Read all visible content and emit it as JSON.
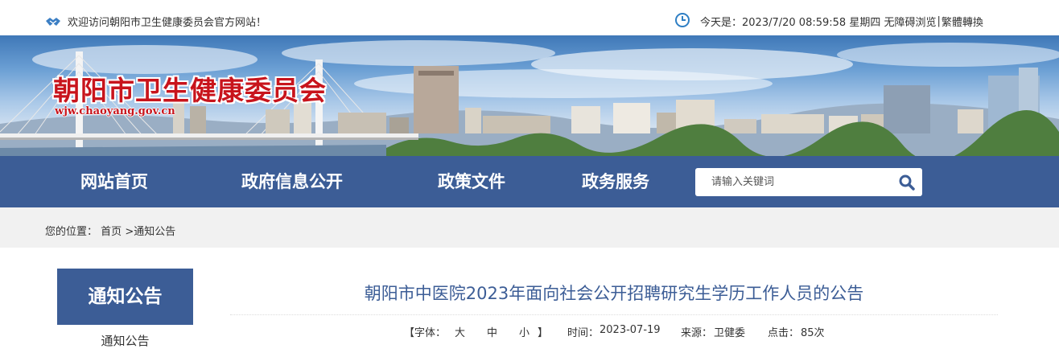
{
  "topbar": {
    "welcome": "欢迎访问朝阳市卫生健康委员会官方网站！",
    "date_prefix": "今天是：",
    "datetime": "2023/7/20 08:59:58 星期四",
    "accessible_link": "无障碍浏览",
    "separator": "|",
    "traditional_link": "繁體轉換"
  },
  "banner": {
    "site_title": "朝阳市卫生健康委员会",
    "site_url": "wjw.chaoyang.gov.cn"
  },
  "nav": {
    "items": [
      {
        "label": "网站首页"
      },
      {
        "label": "政府信息公开"
      },
      {
        "label": "政策文件"
      },
      {
        "label": "政务服务"
      }
    ],
    "search_placeholder": "请输入关键词"
  },
  "breadcrumb": {
    "prefix": "您的位置：",
    "home": "首页",
    "arrow": ">",
    "current": "通知公告"
  },
  "sidebar": {
    "heading": "通知公告",
    "items": [
      {
        "label": "通知公告"
      }
    ]
  },
  "article": {
    "title": "朝阳市中医院2023年面向社会公开招聘研究生学历工作人员的公告",
    "font_label": "【字体：",
    "size_large": "大",
    "size_medium": "中",
    "size_small": "小",
    "font_close": "】",
    "time_label": "时间：",
    "time": "2023-07-19",
    "source_label": "来源：",
    "source": "卫健委",
    "clicks_label": "点击：",
    "clicks": "85次"
  },
  "colors": {
    "nav_blue": "#3c5d96",
    "title_red": "#c8141c",
    "breadcrumb_bg": "#f1f1f1"
  },
  "icons": [
    "handshake-icon",
    "clock-icon",
    "search-icon"
  ]
}
